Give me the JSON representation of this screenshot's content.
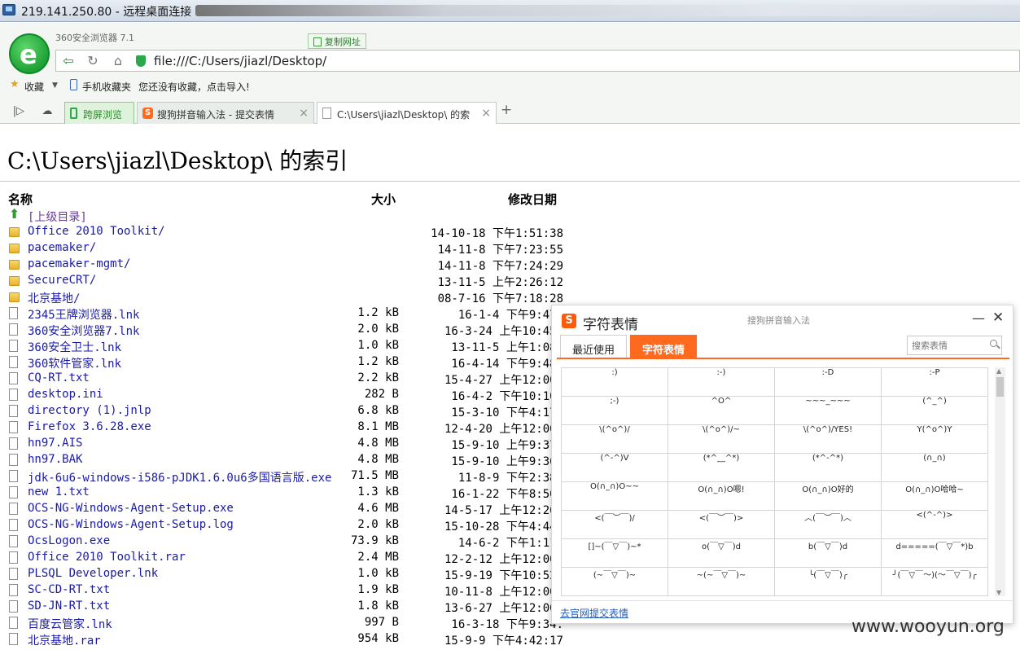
{
  "remote_desktop": {
    "title": "219.141.250.80 - 远程桌面连接"
  },
  "browser": {
    "app_name": "360安全浏览器 7.1",
    "copy_url_label": "复制网址",
    "url": "file:///C:/Users/jiazl/Desktop/",
    "bookmarks": {
      "favorites": "收藏",
      "mobile": "手机收藏夹",
      "empty_msg": "您还没有收藏，点击导入!"
    },
    "tabs": [
      {
        "label": "跨屏浏览"
      },
      {
        "label": "搜狗拼音输入法 - 提交表情"
      },
      {
        "label": "C:\\Users\\jiazl\\Desktop\\ 的索"
      }
    ]
  },
  "page": {
    "heading": "C:\\Users\\jiazl\\Desktop\\ 的索引",
    "columns": {
      "name": "名称",
      "size": "大小",
      "modified": "修改日期"
    },
    "parent_dir": "[上级目录]",
    "entries": [
      {
        "type": "folder",
        "name": "Office 2010 Toolkit/",
        "size": "",
        "date": "14-10-18 下午1:51:38"
      },
      {
        "type": "folder",
        "name": "pacemaker/",
        "size": "",
        "date": "14-11-8 下午7:23:55"
      },
      {
        "type": "folder",
        "name": "pacemaker-mgmt/",
        "size": "",
        "date": "14-11-8 下午7:24:29"
      },
      {
        "type": "folder",
        "name": "SecureCRT/",
        "size": "",
        "date": "13-11-5 上午2:26:12"
      },
      {
        "type": "folder",
        "name": "北京基地/",
        "size": "",
        "date": "08-7-16 下午7:18:28"
      },
      {
        "type": "file",
        "name": "2345王牌浏览器.lnk",
        "size": "1.2 kB",
        "date": "16-1-4 下午9:47:"
      },
      {
        "type": "file",
        "name": "360安全浏览器7.lnk",
        "size": "2.0 kB",
        "date": "16-3-24 上午10:45:"
      },
      {
        "type": "file",
        "name": "360安全卫士.lnk",
        "size": "1.0 kB",
        "date": "13-11-5 上午1:08:"
      },
      {
        "type": "file",
        "name": "360软件管家.lnk",
        "size": "1.2 kB",
        "date": "16-4-14 下午9:48:"
      },
      {
        "type": "file",
        "name": "CQ-RT.txt",
        "size": "2.2 kB",
        "date": "15-4-27 上午12:00:"
      },
      {
        "type": "file",
        "name": "desktop.ini",
        "size": "282 B",
        "date": "16-4-2 下午10:10:"
      },
      {
        "type": "file",
        "name": "directory (1).jnlp",
        "size": "6.8 kB",
        "date": "15-3-10 下午4:17:"
      },
      {
        "type": "file",
        "name": "Firefox 3.6.28.exe",
        "size": "8.1 MB",
        "date": "12-4-20 上午12:00:"
      },
      {
        "type": "file",
        "name": "hn97.AIS",
        "size": "4.8 MB",
        "date": "15-9-10 上午9:37:"
      },
      {
        "type": "file",
        "name": "hn97.BAK",
        "size": "4.8 MB",
        "date": "15-9-10 上午9:36:"
      },
      {
        "type": "file",
        "name": "jdk-6u6-windows-i586-pJDK1.6.0u6多国语言版.exe",
        "size": "71.5 MB",
        "date": "11-8-9 下午2:38:"
      },
      {
        "type": "file",
        "name": "new 1.txt",
        "size": "1.3 kB",
        "date": "16-1-22 下午8:50:"
      },
      {
        "type": "file",
        "name": "OCS-NG-Windows-Agent-Setup.exe",
        "size": "4.6 MB",
        "date": "14-5-17 上午12:26:"
      },
      {
        "type": "file",
        "name": "OCS-NG-Windows-Agent-Setup.log",
        "size": "2.0 kB",
        "date": "15-10-28 下午4:44:"
      },
      {
        "type": "file",
        "name": "OcsLogon.exe",
        "size": "73.9 kB",
        "date": "14-6-2 下午1:11:"
      },
      {
        "type": "file",
        "name": "Office 2010 Toolkit.rar",
        "size": "2.4 MB",
        "date": "12-2-12 上午12:00:"
      },
      {
        "type": "file",
        "name": "PLSQL Developer.lnk",
        "size": "1.0 kB",
        "date": "15-9-19 下午10:52:"
      },
      {
        "type": "file",
        "name": "SC-CD-RT.txt",
        "size": "1.9 kB",
        "date": "10-11-8 上午12:00:"
      },
      {
        "type": "file",
        "name": "SD-JN-RT.txt",
        "size": "1.8 kB",
        "date": "13-6-27 上午12:00:"
      },
      {
        "type": "file",
        "name": "百度云管家.lnk",
        "size": "997 B",
        "date": "16-3-18 下午9:34:"
      },
      {
        "type": "file",
        "name": "北京基地.rar",
        "size": "954 kB",
        "date": "15-9-9 下午4:42:17"
      }
    ]
  },
  "sogou_popup": {
    "title": "字符表情",
    "subtitle": "搜狗拼音输入法",
    "tabs": {
      "recent": "最近使用",
      "emoticons": "字符表情"
    },
    "search_placeholder": "搜索表情",
    "emoticons": [
      ":)",
      ":-)",
      ":-D",
      ":-P",
      ";-)",
      "^O^",
      "~~~_~~~",
      "(^_^)",
      "\\(^o^)/",
      "\\(^o^)/~",
      "\\(^o^)/YES!",
      "Y(^o^)Y",
      "(^-^)V",
      "(*^__^*)",
      "(*^-^*)",
      "(∩_∩)",
      "O(∩_∩)O~~",
      "O(∩_∩)O嗯!",
      "O(∩_∩)O好的",
      "O(∩_∩)O哈哈~",
      "<(￣︶￣)/",
      "<(￣︶￣)>",
      "︿(￣︶￣)︿",
      "<(^-^)>",
      "[]~(￣▽￣)~*",
      "o(￣▽￣)d",
      "b(￣▽￣)d",
      "d=====(￣▽￣*)b",
      "(~￣▽￣)~",
      "~(~￣▽￣)~",
      "╰(￣▽￣)╭",
      "╯(￣▽￣～)(～￣▽￣)╭"
    ],
    "footer_link": "去官网提交表情"
  },
  "watermark": "www.wooyun.org"
}
